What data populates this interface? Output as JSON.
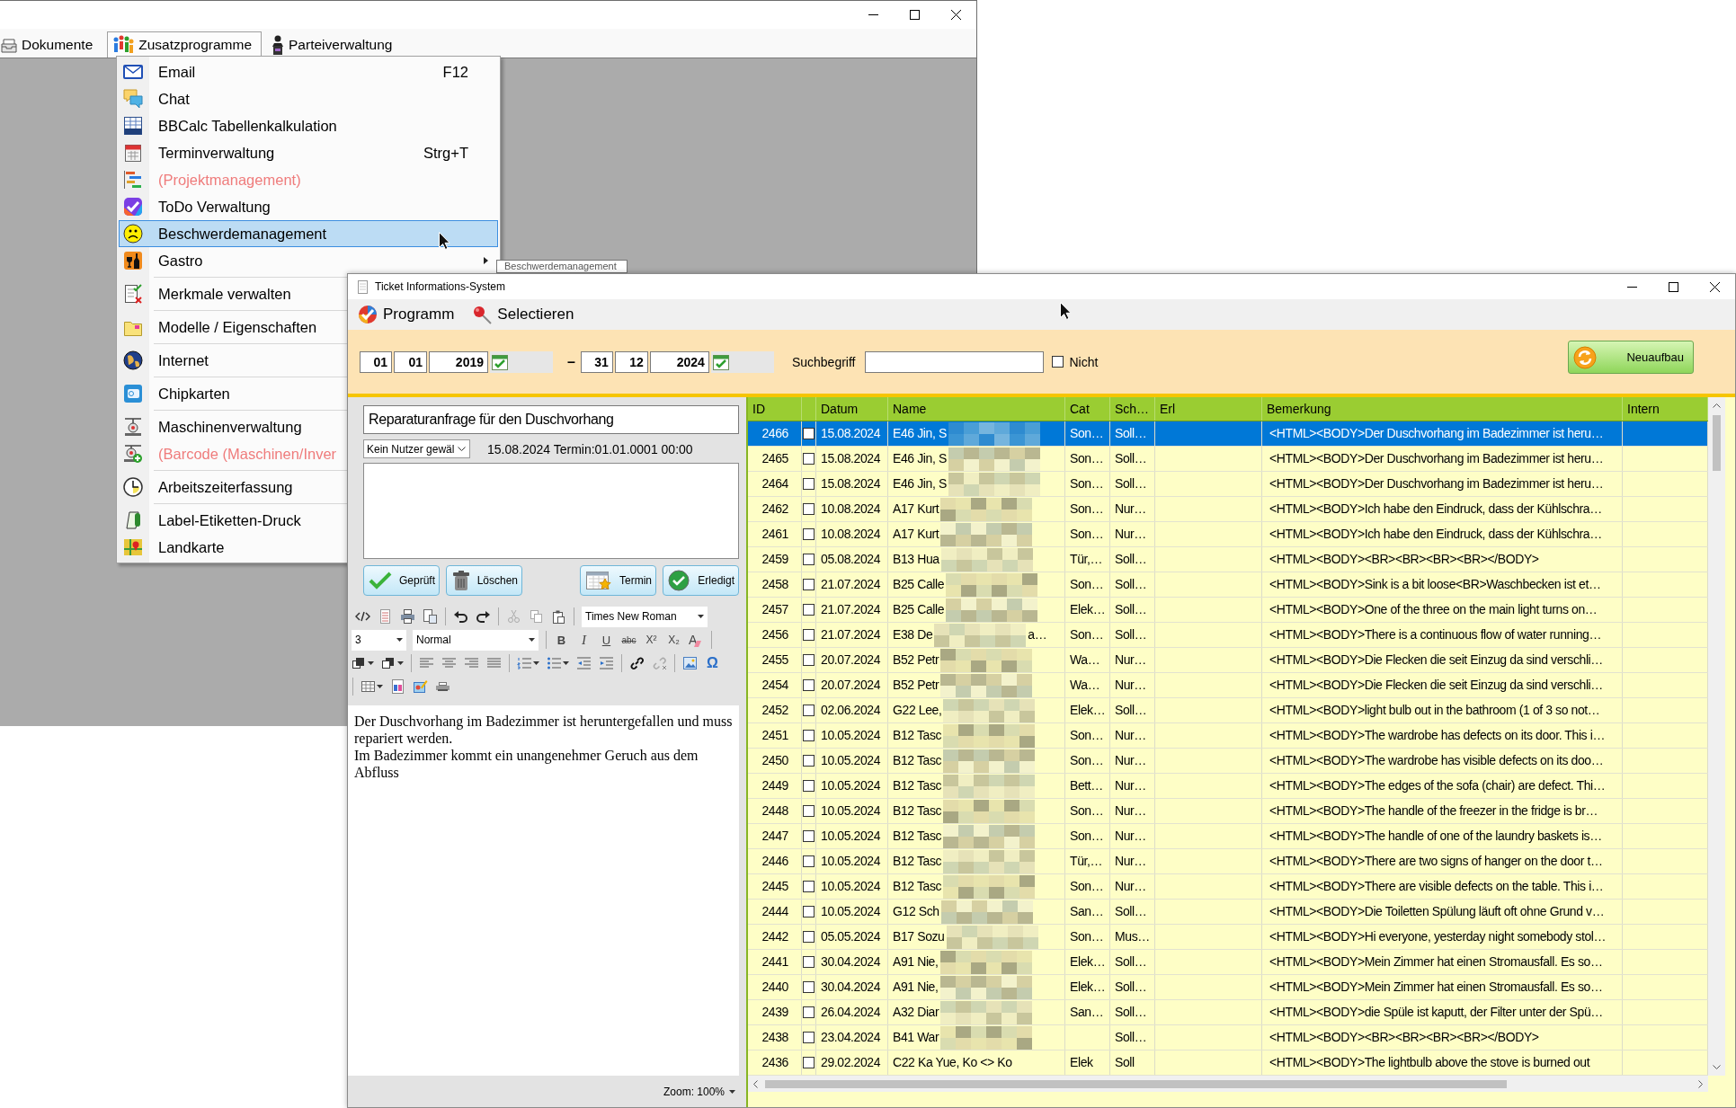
{
  "main_window": {
    "menu_bar": [
      {
        "label": "Dokumente",
        "open": false
      },
      {
        "label": "Zusatzprogramme",
        "open": true
      },
      {
        "label": "Parteiverwaltung",
        "open": false
      }
    ],
    "menu": {
      "groups": [
        [
          {
            "label": "Email",
            "shortcut": "F12",
            "disabled": false,
            "selected": false,
            "submenu": false
          },
          {
            "label": "Chat",
            "disabled": false,
            "selected": false,
            "submenu": false
          },
          {
            "label": "BBCalc Tabellenkalkulation",
            "disabled": false,
            "selected": false,
            "submenu": false
          },
          {
            "label": "Terminverwaltung",
            "shortcut": "Strg+T",
            "disabled": false,
            "selected": false,
            "submenu": false
          },
          {
            "label": "(Projektmanagement)",
            "disabled": true,
            "selected": false,
            "submenu": false
          },
          {
            "label": "ToDo Verwaltung",
            "disabled": false,
            "selected": false,
            "submenu": false
          },
          {
            "label": "Beschwerdemanagement",
            "disabled": false,
            "selected": true,
            "submenu": false
          },
          {
            "label": "Gastro",
            "disabled": false,
            "selected": false,
            "submenu": true
          }
        ],
        [
          {
            "label": "Merkmale verwalten",
            "disabled": false,
            "selected": false
          }
        ],
        [
          {
            "label": "Modelle / Eigenschaften",
            "disabled": false,
            "selected": false
          }
        ],
        [
          {
            "label": "Internet",
            "disabled": false,
            "selected": false
          }
        ],
        [
          {
            "label": "Chipkarten",
            "disabled": false,
            "selected": false
          }
        ],
        [
          {
            "label": "Maschinenverwaltung",
            "disabled": false,
            "selected": false
          },
          {
            "label": "(Barcode (Maschinen/Inver",
            "disabled": true,
            "selected": false
          }
        ],
        [
          {
            "label": "Arbeitszeiterfassung",
            "disabled": false,
            "selected": false
          }
        ],
        [
          {
            "label": "Label-Etiketten-Druck",
            "disabled": false,
            "selected": false
          },
          {
            "label": "Landkarte",
            "disabled": false,
            "selected": false
          }
        ]
      ]
    },
    "tooltip": "Beschwerdemanagement"
  },
  "ticket_window": {
    "title": "Ticket Informations-System",
    "menu": [
      "Programm",
      "Selectieren"
    ],
    "filter": {
      "from": {
        "day": "01",
        "month": "01",
        "year": "2019"
      },
      "range_separator": "–",
      "to": {
        "day": "31",
        "month": "12",
        "year": "2024"
      },
      "search_label": "Suchbegriff",
      "negate": {
        "label": "Nicht",
        "checked": false
      },
      "rebuild_button": "Neuaufbau"
    },
    "detail": {
      "subject": "Reparaturanfrage für den Duschvorhang",
      "user": "Kein Nutzer gewäl",
      "info": "15.08.2024 Termin:01.01.0001 00:00",
      "buttons": [
        "Geprüft",
        "Löschen",
        "Termin",
        "Erledigt"
      ],
      "editor": {
        "font": "Times New Roman",
        "size": "3",
        "block_format": "Normal",
        "format_buttons": [
          {
            "label": "B",
            "kind": "bold"
          },
          {
            "label": "I",
            "kind": "italic"
          },
          {
            "label": "U",
            "kind": "underline"
          },
          {
            "label": "abc",
            "kind": "strike"
          },
          {
            "label": "X²",
            "kind": "superscript"
          },
          {
            "label": "X₂",
            "kind": "subscript"
          },
          {
            "label": "A",
            "kind": "clear"
          }
        ],
        "special_char": "Ω",
        "paragraphs": [
          "Der Duschvorhang im Badezimmer ist heruntergefallen und muss repariert werden.",
          "Im Badezimmer kommt ein unangenehmer Geruch aus dem Abfluss"
        ],
        "zoom": "Zoom: 100%"
      }
    },
    "table": {
      "columns": [
        "ID",
        "Datum",
        "Name",
        "Cat",
        "Sch…",
        "Erl",
        "Bemerkung",
        "Intern"
      ],
      "rows": [
        {
          "id": "2466",
          "checked": false,
          "date": "15.08.2024",
          "name": "E46 Jin, S",
          "redacted": true,
          "cat": "Son…",
          "sch": "Soll…",
          "remark": "<HTML><BODY>Der Duschvorhang im Badezimmer ist heru…",
          "selected": true
        },
        {
          "id": "2465",
          "checked": false,
          "date": "15.08.2024",
          "name": "E46 Jin, S",
          "redacted": true,
          "cat": "Son…",
          "sch": "Soll…",
          "remark": "<HTML><BODY>Der Duschvorhang im Badezimmer ist heru…",
          "selected": false
        },
        {
          "id": "2464",
          "checked": false,
          "date": "15.08.2024",
          "name": "E46 Jin, S",
          "redacted": true,
          "cat": "Son…",
          "sch": "Soll…",
          "remark": "<HTML><BODY>Der Duschvorhang im Badezimmer ist heru…",
          "selected": false
        },
        {
          "id": "2462",
          "checked": false,
          "date": "10.08.2024",
          "name": "A17 Kurt",
          "redacted": true,
          "cat": "Son…",
          "sch": "Nur…",
          "remark": "<HTML><BODY>Ich habe den Eindruck, dass der Kühlschra…",
          "selected": false
        },
        {
          "id": "2461",
          "checked": false,
          "date": "10.08.2024",
          "name": "A17 Kurt",
          "redacted": true,
          "cat": "Son…",
          "sch": "Nur…",
          "remark": "<HTML><BODY>Ich habe den Eindruck, dass der Kühlschra…",
          "selected": false
        },
        {
          "id": "2459",
          "checked": false,
          "date": "05.08.2024",
          "name": "B13 Hua",
          "redacted": true,
          "cat": "Tür,…",
          "sch": "Soll…",
          "remark": "<HTML><BODY><BR><BR><BR><BR></BODY>",
          "selected": false
        },
        {
          "id": "2458",
          "checked": false,
          "date": "21.07.2024",
          "name": "B25 Calle",
          "redacted": true,
          "cat": "Son…",
          "sch": "Soll…",
          "remark": "<HTML><BODY>Sink is a bit loose<BR>Waschbecken ist et…",
          "selected": false
        },
        {
          "id": "2457",
          "checked": false,
          "date": "21.07.2024",
          "name": "B25 Calle",
          "redacted": true,
          "cat": "Elek…",
          "sch": "Soll…",
          "remark": "<HTML><BODY>One of the three on the main light turns on…",
          "selected": false
        },
        {
          "id": "2456",
          "checked": false,
          "date": "21.07.2024",
          "name": "E38  De",
          "name_tail": "a…",
          "redacted": true,
          "cat": "Son…",
          "sch": "Soll…",
          "remark": "<HTML><BODY>There is a continuous flow of water running…",
          "selected": false
        },
        {
          "id": "2455",
          "checked": false,
          "date": "20.07.2024",
          "name": "B52 Petr",
          "redacted": true,
          "cat": "Wa…",
          "sch": "Nur…",
          "remark": "<HTML><BODY>Die Flecken die seit Einzug da sind verschli…",
          "selected": false
        },
        {
          "id": "2454",
          "checked": false,
          "date": "20.07.2024",
          "name": "B52 Petr",
          "redacted": true,
          "cat": "Wa…",
          "sch": "Nur…",
          "remark": "<HTML><BODY>Die Flecken die seit Einzug da sind verschli…",
          "selected": false
        },
        {
          "id": "2452",
          "checked": false,
          "date": "02.06.2024",
          "name": "G22 Lee,",
          "redacted": true,
          "cat": "Elek…",
          "sch": "Soll…",
          "remark": "<HTML><BODY>light bulb out in the bathroom (1 of 3 so not…",
          "selected": false
        },
        {
          "id": "2451",
          "checked": false,
          "date": "10.05.2024",
          "name": "B12 Tasc",
          "redacted": true,
          "cat": "Son…",
          "sch": "Nur…",
          "remark": "<HTML><BODY>The wardrobe has defects on its door. This i…",
          "selected": false
        },
        {
          "id": "2450",
          "checked": false,
          "date": "10.05.2024",
          "name": "B12 Tasc",
          "redacted": true,
          "cat": "Son…",
          "sch": "Nur…",
          "remark": "<HTML><BODY>The wardrobe has visible defects on its doo…",
          "selected": false
        },
        {
          "id": "2449",
          "checked": false,
          "date": "10.05.2024",
          "name": "B12 Tasc",
          "redacted": true,
          "cat": "Bett…",
          "sch": "Nur…",
          "remark": "<HTML><BODY>The edges of the sofa (chair) are defect. Thi…",
          "selected": false
        },
        {
          "id": "2448",
          "checked": false,
          "date": "10.05.2024",
          "name": "B12 Tasc",
          "redacted": true,
          "cat": "Son…",
          "sch": "Nur…",
          "remark": "<HTML><BODY>The handle of the freezer in the fridge is br…",
          "selected": false
        },
        {
          "id": "2447",
          "checked": false,
          "date": "10.05.2024",
          "name": "B12 Tasc",
          "redacted": true,
          "cat": "Son…",
          "sch": "Nur…",
          "remark": "<HTML><BODY>The handle of one of the laundry baskets is…",
          "selected": false
        },
        {
          "id": "2446",
          "checked": false,
          "date": "10.05.2024",
          "name": "B12 Tasc",
          "redacted": true,
          "cat": "Tür,…",
          "sch": "Nur…",
          "remark": "<HTML><BODY>There are two signs of hanger on the door t…",
          "selected": false
        },
        {
          "id": "2445",
          "checked": false,
          "date": "10.05.2024",
          "name": "B12 Tasc",
          "redacted": true,
          "cat": "Son…",
          "sch": "Nur…",
          "remark": "<HTML><BODY>There are visible defects on the table. This i…",
          "selected": false
        },
        {
          "id": "2444",
          "checked": false,
          "date": "10.05.2024",
          "name": "G12 Sch",
          "redacted": true,
          "cat": "San…",
          "sch": "Soll…",
          "remark": "<HTML><BODY>Die Toiletten Spülung läuft oft ohne Grund v…",
          "selected": false
        },
        {
          "id": "2442",
          "checked": false,
          "date": "05.05.2024",
          "name": "B17 Sozu",
          "redacted": true,
          "cat": "Son…",
          "sch": "Mus…",
          "remark": "<HTML><BODY>Hi everyone, yesterday night somebody stol…",
          "selected": false
        },
        {
          "id": "2441",
          "checked": false,
          "date": "30.04.2024",
          "name": "A91 Nie,",
          "redacted": true,
          "cat": "Elek…",
          "sch": "Soll…",
          "remark": "<HTML><BODY>Mein Zimmer hat einen Stromausfall. Es so…",
          "selected": false
        },
        {
          "id": "2440",
          "checked": false,
          "date": "30.04.2024",
          "name": "A91 Nie,",
          "redacted": true,
          "cat": "Elek…",
          "sch": "Soll…",
          "remark": "<HTML><BODY>Mein Zimmer hat einen Stromausfall. Es so…",
          "selected": false
        },
        {
          "id": "2439",
          "checked": false,
          "date": "26.04.2024",
          "name": "A32 Diar",
          "redacted": true,
          "cat": "San…",
          "sch": "Soll…",
          "remark": "<HTML><BODY>die Spüle ist kaputt, der Filter unter der Spü…",
          "selected": false
        },
        {
          "id": "2438",
          "checked": false,
          "date": "23.04.2024",
          "name": "B41 War",
          "redacted": true,
          "sch": "Soll…",
          "remark": "<HTML><BODY><BR><BR><BR><BR></BODY>",
          "selected": false
        },
        {
          "id": "2436",
          "checked": false,
          "date": "29.02.2024",
          "name": "C22 Ka Yue, Ko <> Ko",
          "redacted": false,
          "cat": "Elek",
          "sch": "Soll",
          "remark": "<HTML><BODY>The lightbulb above the stove is burned out",
          "selected": false
        }
      ]
    }
  }
}
